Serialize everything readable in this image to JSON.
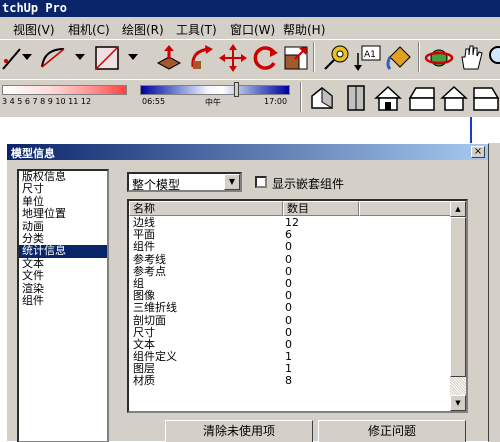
{
  "app": {
    "title_fragment": "tchUp Pro"
  },
  "menu": [
    {
      "label": "视图(V)"
    },
    {
      "label": "相机(C)"
    },
    {
      "label": "绘图(R)"
    },
    {
      "label": "工具(T)"
    },
    {
      "label": "窗口(W)"
    },
    {
      "label": "帮助(H)"
    }
  ],
  "toolbar1": {
    "icons": [
      "line-tool-icon",
      "arc-tool-icon",
      "rectangle-tool-icon",
      "push-pull-icon",
      "follow-me-icon",
      "move-icon",
      "rotate-icon",
      "scale-icon",
      "tape-measure-icon",
      "text-icon",
      "paint-bucket-icon",
      "orbit-icon",
      "pan-icon"
    ],
    "text_label": "A1"
  },
  "shadow": {
    "month_ticks": "3  4  5  6  7  8  9  10 11 12",
    "time_start": "06:55",
    "time_mid": "中午",
    "time_end": "17:00"
  },
  "views": [
    "iso-view-icon",
    "top-view-icon",
    "front-view-icon",
    "right-view-icon",
    "back-view-icon",
    "left-view-icon"
  ],
  "dialog": {
    "title": "模型信息",
    "close": "×",
    "categories": [
      "版权信息",
      "尺寸",
      "单位",
      "地理位置",
      "动画",
      "分类",
      "统计信息",
      "文本",
      "文件",
      "渲染",
      "组件"
    ],
    "selected_index": 6,
    "scope": "整个模型",
    "show_nested_label": "显示嵌套组件",
    "show_nested_checked": false,
    "table": {
      "col_name": "名称",
      "col_count": "数目",
      "rows": [
        {
          "name": "边线",
          "count": "12"
        },
        {
          "name": "平面",
          "count": "6"
        },
        {
          "name": "组件",
          "count": "0"
        },
        {
          "name": "参考线",
          "count": "0"
        },
        {
          "name": "参考点",
          "count": "0"
        },
        {
          "name": "组",
          "count": "0"
        },
        {
          "name": "图像",
          "count": "0"
        },
        {
          "name": "三维折线",
          "count": "0"
        },
        {
          "name": "剖切面",
          "count": "0"
        },
        {
          "name": "尺寸",
          "count": "0"
        },
        {
          "name": "文本",
          "count": "0"
        },
        {
          "name": "组件定义",
          "count": "1"
        },
        {
          "name": "图层",
          "count": "1"
        },
        {
          "name": "材质",
          "count": "8"
        }
      ]
    },
    "purge_button": "清除未使用项",
    "fix_button": "修正问题"
  },
  "colors": {
    "title_blue": "#0a246a",
    "face": "#d4d0c8",
    "selection": "#0a246a"
  }
}
